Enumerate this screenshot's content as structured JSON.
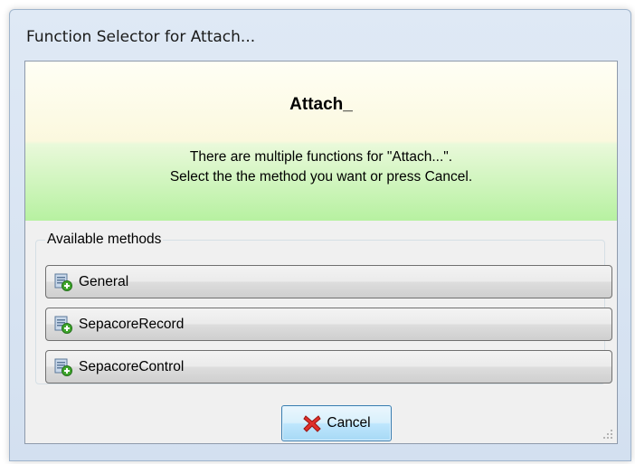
{
  "window": {
    "title": "Function Selector for Attach..."
  },
  "banner": {
    "title": "Attach_",
    "line1": "There are multiple functions for \"Attach...\".",
    "line2": "Select the the method you want or press Cancel."
  },
  "methods": {
    "legend": "Available methods",
    "items": [
      {
        "label": "General",
        "icon": "method-add-icon"
      },
      {
        "label": "SepacoreRecord",
        "icon": "method-add-icon"
      },
      {
        "label": "SepacoreControl",
        "icon": "method-add-icon"
      }
    ]
  },
  "buttons": {
    "cancel_label": "Cancel",
    "cancel_icon": "red-x-icon"
  },
  "colors": {
    "banner_top": "#fbf8de",
    "banner_bottom": "#b7f1a1",
    "cancel_border": "#3c7fb1"
  }
}
